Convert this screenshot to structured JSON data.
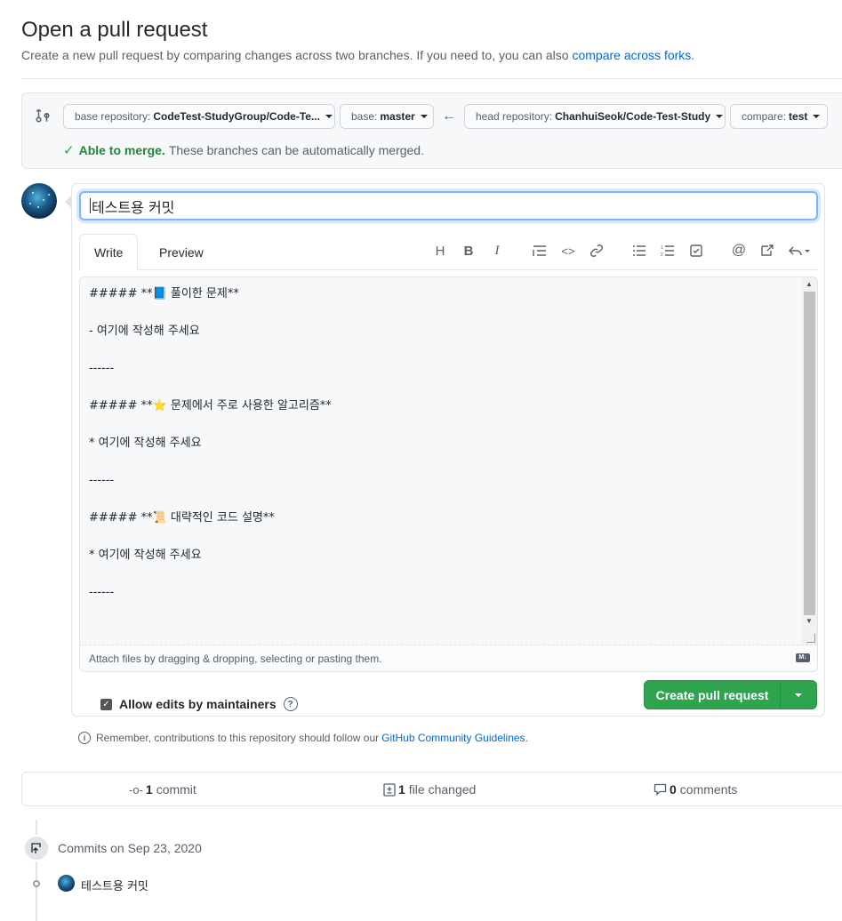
{
  "header": {
    "title": "Open a pull request",
    "subtitle": "Create a new pull request by comparing changes across two branches. If you need to, you can also",
    "subtitle_link": "compare across forks",
    "subtitle_end": "."
  },
  "range": {
    "base_repo_label": "base repository:",
    "base_repo_value": "CodeTest-StudyGroup/Code-Te...",
    "base_label": "base:",
    "base_value": "master",
    "arrow": "←",
    "head_repo_label": "head repository:",
    "head_repo_value": "ChanhuiSeok/Code-Test-Study",
    "compare_label": "compare:",
    "compare_value": "test",
    "merge_ok": "Able to merge.",
    "merge_text": "These branches can be automatically merged."
  },
  "form": {
    "title_value": "테스트용 커밋",
    "tab_write": "Write",
    "tab_preview": "Preview",
    "toolbar": {
      "heading": "H",
      "bold": "B",
      "italic": "I",
      "quote": "quote-icon",
      "code": "<>",
      "link": "link-icon",
      "bullets": "unordered-list-icon",
      "numbers": "ordered-list-icon",
      "tasks": "task-list-icon",
      "mention": "@",
      "reference": "cross-reference-icon",
      "reply": "saved-reply-icon"
    },
    "body_lines": [
      "##### **📘 풀이한 문제**",
      "- 여기에 작성해 주세요",
      "------",
      "##### **⭐ 문제에서 주로 사용한 알고리즘**",
      "* 여기에 작성해 주세요",
      "------",
      "##### **📜 대략적인 코드 설명**",
      "* 여기에 작성해 주세요",
      "------"
    ],
    "attach_text": "Attach files by dragging & dropping, selecting or pasting them.",
    "md_badge": "M↓",
    "allow_edits": "Allow edits by maintainers",
    "allow_edits_checked": true,
    "help": "?",
    "create_button": "Create pull request"
  },
  "guidelines": {
    "text": "Remember, contributions to this repository should follow our",
    "link": "GitHub Community Guidelines",
    "end": "."
  },
  "stats": {
    "commits_count": "1",
    "commits_label": "commit",
    "files_count": "1",
    "files_label": "file changed",
    "comments_count": "0",
    "comments_label": "comments"
  },
  "timeline": {
    "commits_on": "Commits on Sep 23, 2020",
    "commit_message": "테스트용 커밋"
  },
  "colors": {
    "accent": "#0366d6",
    "primary_button": "#2ea44f",
    "success_text": "#22863a",
    "focus_ring": "#79b8ff"
  }
}
